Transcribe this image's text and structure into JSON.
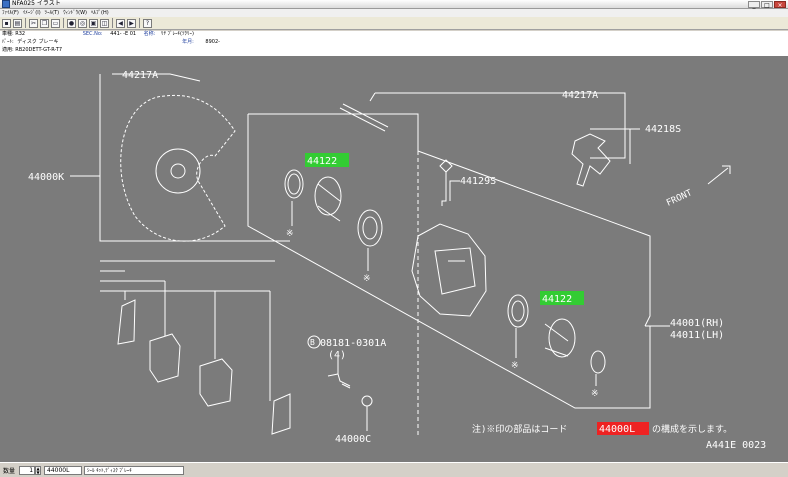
{
  "window": {
    "title": "NFA025 イラスト",
    "minimize": "_",
    "maximize": "□",
    "close": "×"
  },
  "menu": [
    "ﾌｧｲﾙ(F)",
    "ｲﾒｰｼﾞ(I)",
    "ﾂｰﾙ(T)",
    "ｳｨﾝﾄﾞｳ(W)",
    "ﾍﾙﾌﾟ(H)"
  ],
  "toolbar": {
    "icons": [
      "save-icon",
      "print-icon",
      "cut-icon",
      "copy-icon",
      "paste-icon",
      "zoom-in-icon",
      "zoom-out-icon",
      "find-icon",
      "fit-icon",
      "prev-icon",
      "next-icon",
      "help-icon"
    ]
  },
  "info": {
    "model_label": "車種:",
    "model_value": "R32",
    "sec_label": "SEC.No:",
    "sec_value": "441- -E 01",
    "name_label": "名称:",
    "name_value": "ﾘﾔ ﾌﾞﾚｰｷ(ﾂｸﾘｰ)",
    "part_label": "ﾊﾟｰﾄ:",
    "part_value": "ディスク ブレーキ",
    "apply_label": "適用:",
    "apply_value": "RB20DETT-GT-R-T7",
    "year_label": "年月:",
    "year_value": "8902-"
  },
  "diagram": {
    "labels": {
      "p44217A_left": "44217A",
      "p44217A_right": "44217A",
      "p44218S": "44218S",
      "p44000K": "44000K",
      "p44129S": "44129S",
      "p44122_top": "44122",
      "p44122_bottom": "44122",
      "p44001": "44001(RH)",
      "p44011": "44011(LH)",
      "bolt_circle": "B",
      "bolt_num": "08181-0301A",
      "bolt_qty": "(4)",
      "p44000C": "44000C",
      "front": "FRONT",
      "note_prefix": "注)※印の部品はコード",
      "note_code": "44000L",
      "note_suffix": "の構成を示します。",
      "code": "A441E 0023",
      "mark": "※"
    },
    "colors": {
      "background": "#7b7b7b",
      "line": "#ffffff",
      "highlight_green": "#33cc33",
      "highlight_red": "#ee2222"
    }
  },
  "status": {
    "qty_label": "数量",
    "qty_value": "1",
    "part_no": "44000L",
    "part_name": "ｼｰﾙ ｷｯﾄ,ﾃﾞｨｽｸ ﾌﾞﾚｰｷ"
  }
}
